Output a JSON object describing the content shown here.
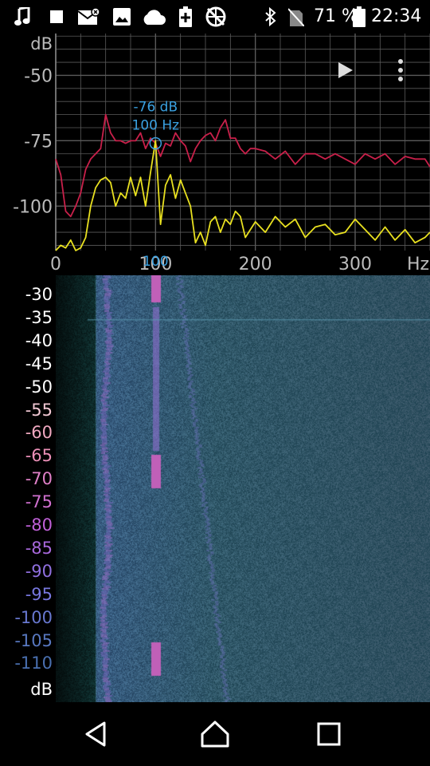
{
  "status_bar": {
    "battery_percent": "71 %",
    "time": "22:34",
    "icons": [
      "music-icon",
      "stop-icon",
      "email-icon",
      "image-icon",
      "cloud-icon",
      "battery-saver-icon",
      "sync-disabled-icon",
      "bluetooth-icon",
      "no-signal-icon",
      "battery-icon"
    ]
  },
  "spectrum": {
    "y_unit": "dB",
    "y_ticks": [
      "-50",
      "-75",
      "-100"
    ],
    "x_ticks": [
      "0",
      "100",
      "200",
      "300"
    ],
    "x_unit": "Hz",
    "cursor": {
      "freq_value": 100,
      "db_value": -76,
      "db_label": "-76 dB",
      "hz_label": "100 Hz",
      "axis_marker": "100"
    },
    "colors": {
      "grid": "#5a5a5a",
      "peak_hold": "#c8204a",
      "live": "#e8e020",
      "cursor": "#3aa0e0"
    },
    "chart_data": {
      "type": "line",
      "title": "",
      "xlabel": "Hz",
      "ylabel": "dB",
      "xlim": [
        0,
        375
      ],
      "ylim": [
        -117,
        -34
      ],
      "series": [
        {
          "name": "",
          "x": [
            0,
            5,
            10,
            15,
            20,
            25,
            30,
            35,
            40,
            45,
            50,
            55,
            60,
            65,
            70,
            75,
            80,
            85,
            90,
            95,
            100,
            105,
            110,
            115,
            120,
            125,
            130,
            135,
            140,
            145,
            150,
            155,
            160,
            165,
            170,
            175,
            180,
            185,
            190,
            195,
            200,
            210,
            220,
            230,
            240,
            250,
            260,
            270,
            280,
            290,
            300,
            310,
            320,
            330,
            340,
            350,
            360,
            370,
            375
          ],
          "y": [
            -82,
            -88,
            -102,
            -104,
            -100,
            -95,
            -86,
            -82,
            -80,
            -78,
            -65,
            -72,
            -75,
            -75,
            -76,
            -75,
            -75,
            -72,
            -78,
            -74,
            -76,
            -81,
            -76,
            -77,
            -72,
            -75,
            -77,
            -83,
            -78,
            -75,
            -73,
            -72,
            -75,
            -70,
            -67,
            -74,
            -74,
            -78,
            -80,
            -78,
            -78,
            -79,
            -82,
            -79,
            -84,
            -80,
            -80,
            -82,
            -80,
            -82,
            -84,
            -80,
            -82,
            -80,
            -84,
            -81,
            -82,
            -82,
            -85
          ]
        },
        {
          "name": "",
          "x": [
            0,
            5,
            10,
            15,
            20,
            25,
            30,
            35,
            40,
            45,
            50,
            55,
            60,
            65,
            70,
            75,
            80,
            85,
            90,
            95,
            100,
            105,
            110,
            115,
            120,
            125,
            130,
            135,
            140,
            145,
            150,
            155,
            160,
            165,
            170,
            175,
            180,
            185,
            190,
            200,
            210,
            220,
            230,
            240,
            250,
            260,
            270,
            280,
            290,
            300,
            310,
            320,
            330,
            340,
            350,
            360,
            370,
            375
          ],
          "y": [
            -117,
            -115,
            -116,
            -113,
            -117,
            -116,
            -112,
            -100,
            -93,
            -90,
            -89,
            -91,
            -100,
            -95,
            -97,
            -89,
            -96,
            -89,
            -100,
            -87,
            -75,
            -107,
            -92,
            -88,
            -97,
            -90,
            -95,
            -100,
            -114,
            -110,
            -115,
            -106,
            -104,
            -110,
            -105,
            -107,
            -102,
            -104,
            -112,
            -106,
            -110,
            -104,
            -108,
            -105,
            -112,
            -108,
            -107,
            -111,
            -110,
            -105,
            -109,
            -113,
            -108,
            -113,
            -109,
            -114,
            -112,
            -110
          ]
        }
      ]
    }
  },
  "waterfall": {
    "y_labels": [
      "-30",
      "-35",
      "-40",
      "-45",
      "-50",
      "-55",
      "-60",
      "-65",
      "-70",
      "-75",
      "-80",
      "-85",
      "-90",
      "-95",
      "-100",
      "-105",
      "-110",
      "dB"
    ],
    "label_colors": [
      "#ffffff",
      "#ffffff",
      "#ffffff",
      "#ffffff",
      "#ffffff",
      "#f2c8d4",
      "#f0a8c0",
      "#ec90b8",
      "#e080c8",
      "#d070d0",
      "#c060d8",
      "#a868dc",
      "#9070e0",
      "#7878e0",
      "#6878d0",
      "#5878c0",
      "#4a70b0",
      "#ffffff"
    ]
  },
  "nav": {
    "icons": [
      "back-icon",
      "home-icon",
      "recents-icon"
    ]
  }
}
